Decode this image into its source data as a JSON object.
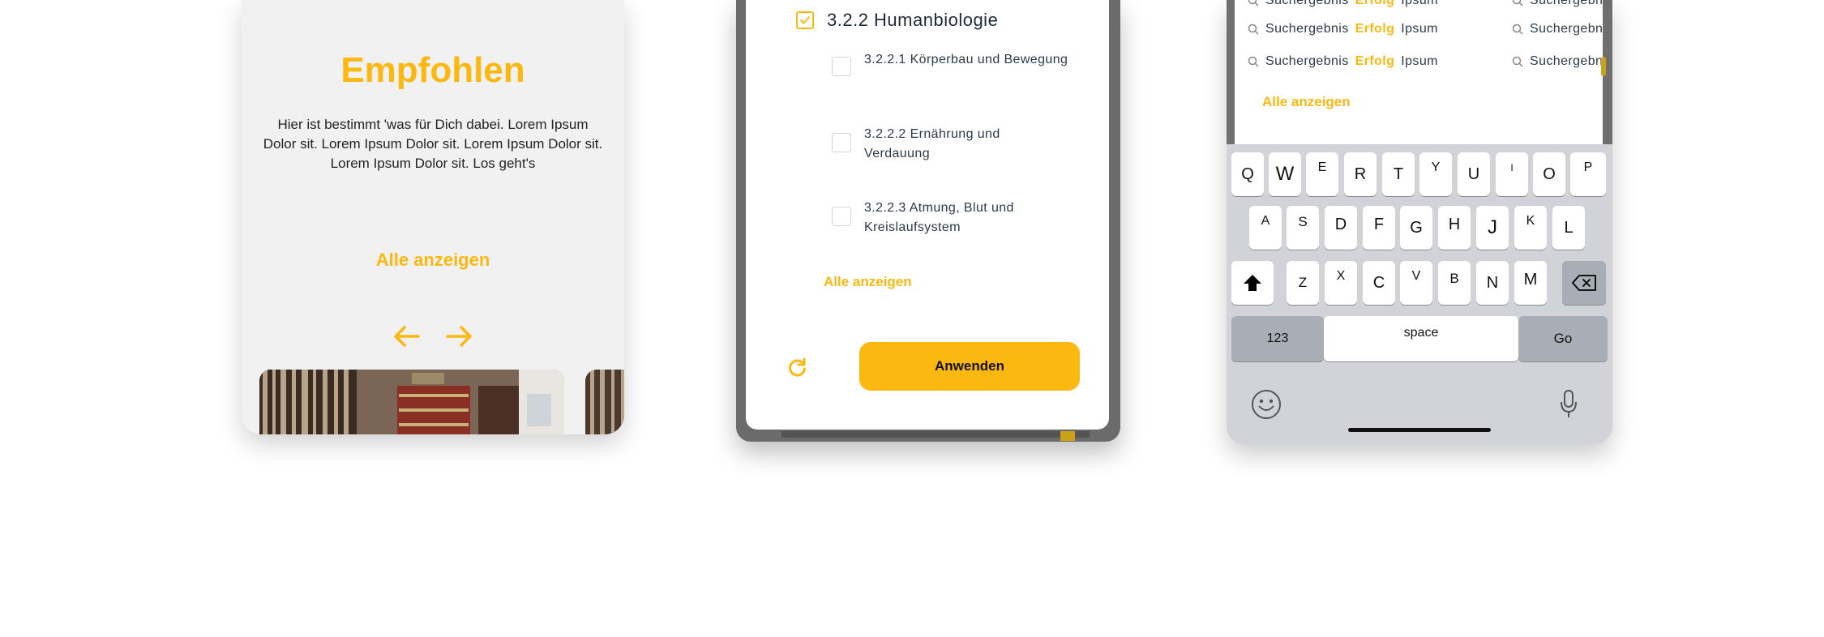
{
  "panel1": {
    "title": "Empfohlen",
    "body": "Hier ist bestimmt 'was für Dich dabei. Lorem Ipsum Dolor sit. Lorem Ipsum Dolor sit. Lorem Ipsum Dolor sit. Lorem Ipsum Dolor sit. Los geht's",
    "link": "Alle anzeigen",
    "arrows": [
      "arrow-left-icon",
      "arrow-right-icon"
    ],
    "accent": "#fbb811"
  },
  "panel2": {
    "main_item": "3.2.2 Humanbiologie",
    "main_checked": true,
    "sub_items": [
      {
        "label": "3.2.2.1 Körperbau und Bewegung",
        "checked": false
      },
      {
        "label": "3.2.2.2 Ernährung und Verdauung",
        "checked": false
      },
      {
        "label": "3.2.2.3 Atmung, Blut und Kreislaufsystem",
        "checked": false
      }
    ],
    "link": "Alle anzeigen",
    "apply_label": "Anwenden",
    "reset_icon": "refresh-icon"
  },
  "panel3": {
    "results": [
      {
        "pre": "Suchergebnis ",
        "hl": "Erfolg",
        "post": " Ipsum"
      },
      {
        "pre": "Suchergebnis ",
        "hl": "Erfolg",
        "post": " Ipsum"
      },
      {
        "pre": "Suchergebnis ",
        "hl": "Erfolg",
        "post": " Ipsum"
      }
    ],
    "results_col2": [
      "Suchergebnis",
      "Suchergebnis",
      "Suchergebnis"
    ],
    "link": "Alle anzeigen",
    "keyboard": {
      "row1": [
        "Q",
        "W",
        "E",
        "R",
        "T",
        "Y",
        "U",
        "I",
        "O",
        "P"
      ],
      "row2": [
        "A",
        "S",
        "D",
        "F",
        "G",
        "H",
        "J",
        "K",
        "L"
      ],
      "row3": [
        "Z",
        "X",
        "C",
        "V",
        "B",
        "N",
        "M"
      ],
      "numbers_label": "123",
      "space_label": "space",
      "go_label": "Go",
      "icons": [
        "shift-icon",
        "backspace-icon",
        "emoji-icon",
        "microphone-icon"
      ]
    }
  }
}
